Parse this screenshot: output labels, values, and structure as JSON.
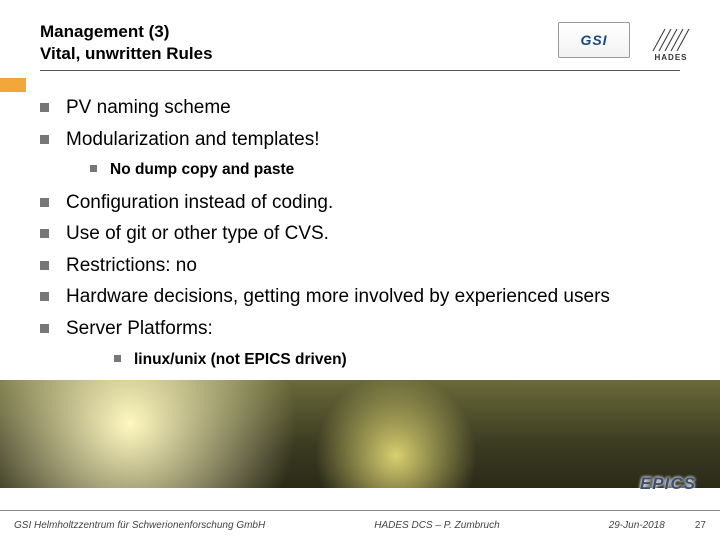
{
  "header": {
    "title_line1": "Management (3)",
    "title_line2": "Vital, unwritten Rules"
  },
  "logos": {
    "gsi": "GSI",
    "hades": "HADES",
    "epics": "EPICS"
  },
  "bullets": [
    {
      "text": "PV naming scheme"
    },
    {
      "text": "Modularization and templates!",
      "children": [
        {
          "text": "No dump copy and paste"
        }
      ]
    },
    {
      "text": "Configuration instead of coding."
    },
    {
      "text": "Use of git or other type of CVS."
    },
    {
      "text": "Restrictions: no"
    },
    {
      "text": "Hardware decisions, getting more involved by experienced users"
    },
    {
      "text": "Server Platforms:",
      "children": [
        {
          "text": "linux/unix (not EPICS driven)"
        }
      ]
    }
  ],
  "footer": {
    "org": "GSI Helmholtzzentrum für Schwerionenforschung GmbH",
    "center": "HADES DCS – P. Zumbruch",
    "date": "29-Jun-2018",
    "page": "27"
  }
}
